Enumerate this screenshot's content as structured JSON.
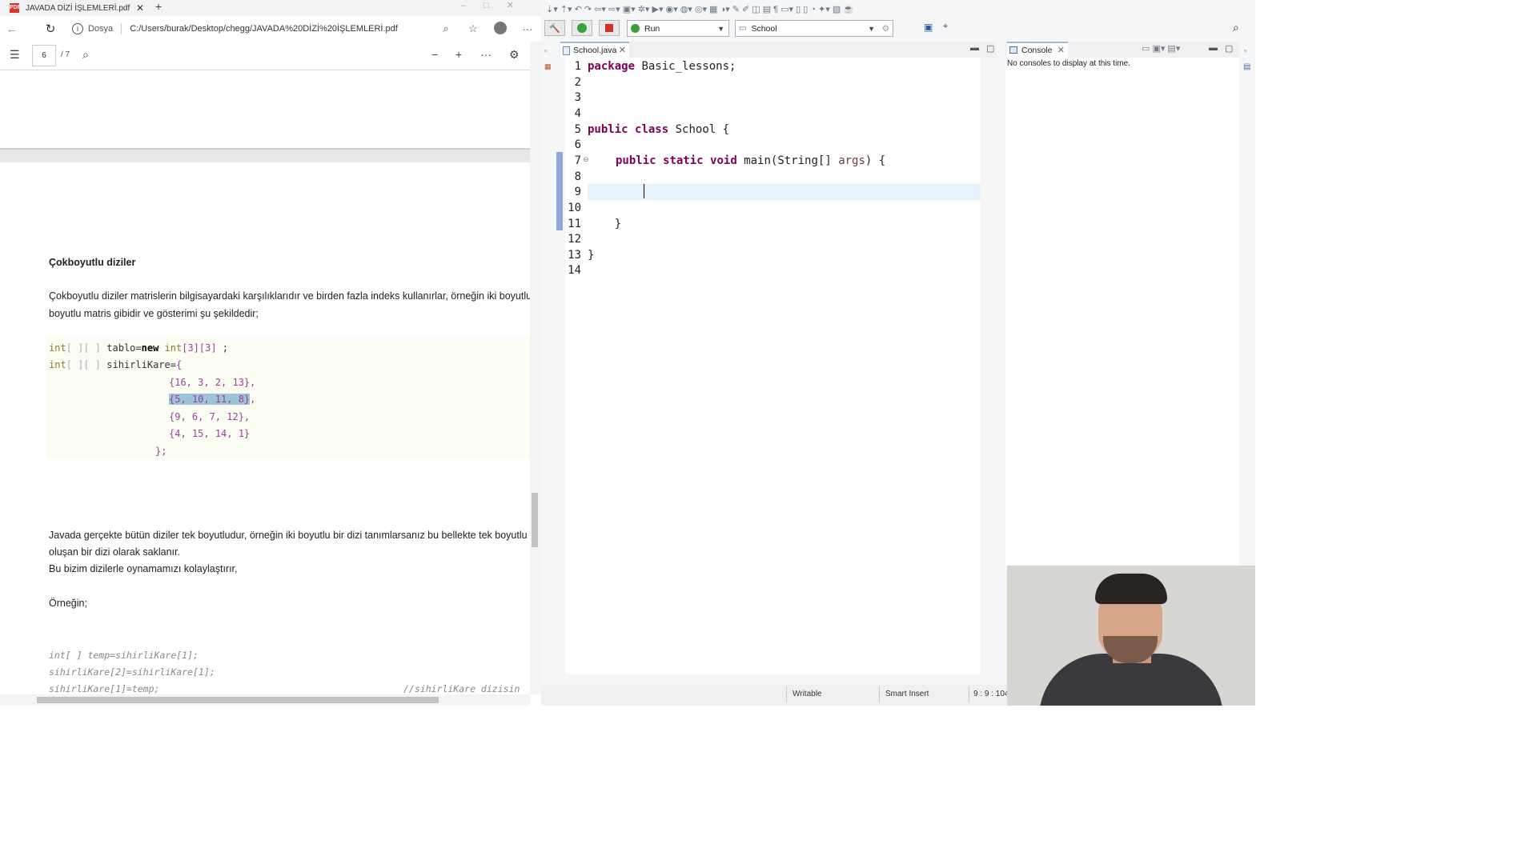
{
  "browser": {
    "tab_title": "JAVADA DİZİ İŞLEMLERİ.pdf",
    "tab_close": "✕",
    "new_tab": "+",
    "url_label": "Dosya",
    "url": "C:/Users/burak/Desktop/chegg/JAVADA%20D%C4%B0Z%C4%B0%20%C4%B0%C5%9ELEMLER%C4%B0.pdf",
    "url_display": "C:/Users/burak/Desktop/chegg/JAVADA%20DİZİ%20İŞLEMLERİ.pdf",
    "more_label": "···"
  },
  "pdf_toolbar": {
    "page_current": "6",
    "page_total": "/ 7",
    "zoom_out": "−",
    "zoom_in": "+",
    "more": "···"
  },
  "pdf": {
    "heading": "Çokboyutlu diziler",
    "para1_line1": "Çokboyutlu diziler matrislerin bilgisayardaki karşılıklarıdır ve birden fazla indeks kullanırlar, örneğin iki boyutlu bir dizi",
    "para1_line2": "boyutlu matris gibidir ve gösterimi şu şekildedir;",
    "code": {
      "l1_type": "int",
      "l1_brackets": "[ ][ ]",
      "l1_name": " tablo=",
      "l1_new": "new",
      "l1_type2": " int",
      "l1_dims": "[3][3]",
      "l1_end": " ;",
      "l2_type": "int",
      "l2_brackets": "[ ][ ]",
      "l2_name": " sihirliKare=",
      "l2_open": "{",
      "row1": "{16, 3, 2, 13},",
      "row2": "{5, 10, 11, 8}",
      "row2_end": ",",
      "row3": "{9, 6, 7, 12},",
      "row4": "{4, 15, 14, 1}",
      "close": "};"
    },
    "para2_line1": "Javada gerçekte bütün diziler tek boyutludur, örneğin iki boyutlu bir dizi tanımlarsanız bu bellekte tek boyutlu diziler",
    "para2_line2": "oluşan bir dizi olarak saklanır.",
    "para2_line3": "Bu bizim dizilerle oynamamızı kolaylaştırır,",
    "example_label": "Örneğin;",
    "ex_line1": "int[ ] temp=sihirliKare[1];",
    "ex_line2": "sihirliKare[2]=sihirliKare[1];",
    "ex_line3": "sihirliKare[1]=temp;",
    "ex_comment": "//sihirliKare dizisin"
  },
  "eclipse": {
    "run_label": "Run",
    "config_label": "School",
    "editor_tab": "School.java",
    "console_tab": "Console",
    "console_message": "No consoles to display at this time.",
    "line_numbers": [
      "1",
      "2",
      "3",
      "4",
      "5",
      "6",
      "7",
      "8",
      "9",
      "10",
      "11",
      "12",
      "13",
      "14"
    ],
    "code": {
      "l1_kw": "package",
      "l1_rest": " Basic_lessons;",
      "l5_kw1": "public",
      "l5_kw2": "class",
      "l5_rest": " School {",
      "l7_kw1": "public",
      "l7_kw2": "static",
      "l7_kw3": "void",
      "l7_rest1": " main(String[] ",
      "l7_param": "args",
      "l7_rest2": ") {",
      "l11": "    }",
      "l13": "}"
    },
    "status": {
      "writable": "Writable",
      "insert_mode": "Smart Insert",
      "position": "9 : 9 : 104"
    }
  },
  "colors": {
    "java_keyword": "#7f0055",
    "current_line": "#e8f2fe",
    "pdf_highlight": "#9dc3d6",
    "code_bg": "#fbfdf2"
  },
  "icons": [
    "pdf-icon",
    "back-icon",
    "refresh-icon",
    "info-icon",
    "zoom-icon",
    "favorites-icon",
    "profile-icon",
    "more-icon",
    "toc-icon",
    "search-icon",
    "settings-icon",
    "run-icon",
    "stop-icon",
    "build-icon",
    "java-file-icon",
    "console-icon",
    "minimize-icon",
    "maximize-icon",
    "webcam-overlay"
  ]
}
